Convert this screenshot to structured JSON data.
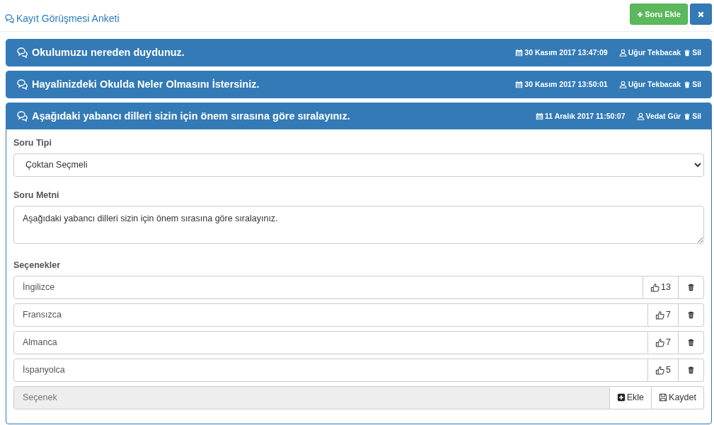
{
  "page": {
    "title": "Kayıt Görüşmesi Anketi",
    "add_button": "Soru Ekle"
  },
  "questions": [
    {
      "title": "Okulumuzu nereden duydunuz.",
      "date": "30 Kasım 2017 13:47:09",
      "author": "Uğur Tekbacak",
      "delete": "Sil",
      "expanded": false
    },
    {
      "title": "Hayalinizdeki Okulda Neler Olmasını İstersiniz.",
      "date": "30 Kasım 2017 13:50:01",
      "author": "Uğur Tekbacak",
      "delete": "Sil",
      "expanded": false
    },
    {
      "title": "Aşağıdaki yabancı dilleri sizin için önem sırasına göre sıralayınız.",
      "date": "11 Aralık 2017 11:50:07",
      "author": "Vedat Gür",
      "delete": "Sil",
      "expanded": true,
      "detail": {
        "type_label": "Soru Tipi",
        "type_value": "Çoktan Seçmeli",
        "text_label": "Soru Metni",
        "text_value": "Aşağıdaki yabancı dilleri sizin için önem sırasına göre sıralayınız.",
        "options_label": "Seçenekler",
        "options": [
          {
            "text": "İngilizce",
            "votes": "13"
          },
          {
            "text": "Fransızca",
            "votes": "7"
          },
          {
            "text": "Almanca",
            "votes": "7"
          },
          {
            "text": "İspanyolca",
            "votes": "5"
          }
        ],
        "new_option": {
          "placeholder": "Seçenek",
          "add": "Ekle",
          "save": "Kaydet"
        }
      }
    }
  ]
}
